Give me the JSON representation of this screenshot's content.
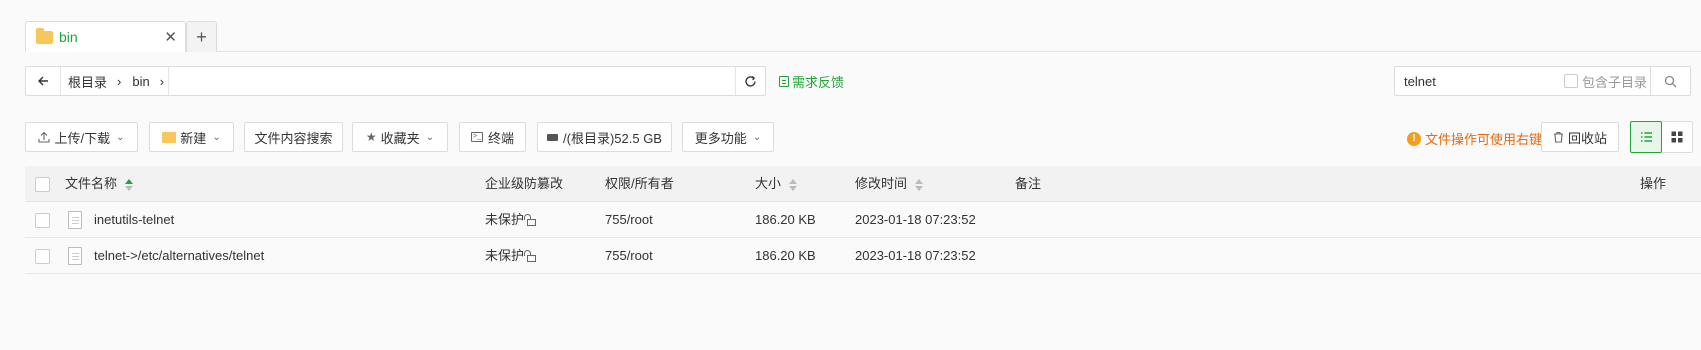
{
  "tab": {
    "label": "bin",
    "close": "✕",
    "add": "+"
  },
  "path": {
    "back_icon": "arrow-left-icon",
    "crumbs": [
      "根目录",
      "bin"
    ],
    "separator": "›"
  },
  "feedback": "需求反馈",
  "search": {
    "value": "telnet",
    "subdir_label": "包含子目录"
  },
  "toolbar": {
    "upload_download": "上传/下载",
    "new": "新建",
    "content_search": "文件内容搜索",
    "favorites": "收藏夹",
    "terminal": "终端",
    "disk": "/(根目录)52.5 GB",
    "more": "更多功能"
  },
  "hint": "文件操作可使用右键",
  "recycle": "回收站",
  "table": {
    "headers": {
      "name": "文件名称",
      "protect": "企业级防篡改",
      "perm": "权限/所有者",
      "size": "大小",
      "mtime": "修改时间",
      "note": "备注",
      "ops": "操作"
    },
    "rows": [
      {
        "name": "inetutils-telnet",
        "protect": "未保护",
        "perm": "755/root",
        "size": "186.20 KB",
        "mtime": "2023-01-18 07:23:52",
        "note": ""
      },
      {
        "name": "telnet->/etc/alternatives/telnet",
        "protect": "未保护",
        "perm": "755/root",
        "size": "186.20 KB",
        "mtime": "2023-01-18 07:23:52",
        "note": ""
      }
    ]
  },
  "colors": {
    "accent": "#20a53a",
    "warning": "#e6690d",
    "folder": "#f7c75b"
  }
}
